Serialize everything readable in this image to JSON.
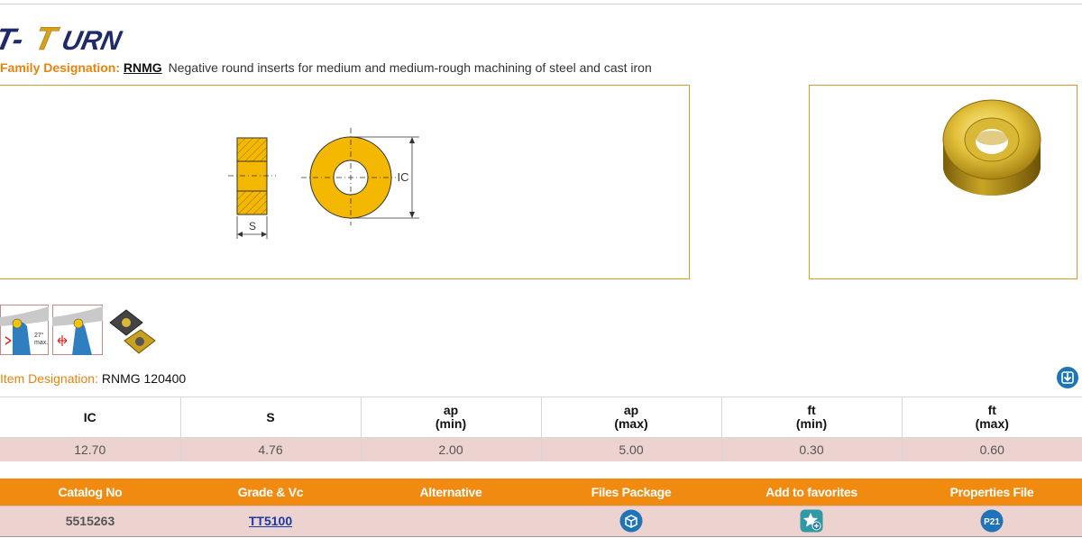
{
  "logo": {
    "text": "T-TURN",
    "colors": {
      "dark": "#1f2a6b",
      "gold": "#d7a21a"
    }
  },
  "family": {
    "label": "Family Designation:",
    "code": "RNMG",
    "description": "Negative round inserts for medium and medium-rough machining of steel and cast iron"
  },
  "drawing": {
    "dim_s": "S",
    "dim_ic": "IC"
  },
  "thumbs": {
    "angle_label_1": "27°",
    "angle_label_2": "max."
  },
  "item": {
    "label": "Item Designation:",
    "value": "RNMG 120400"
  },
  "dims_table": {
    "headers": [
      {
        "line1": "IC",
        "line2": ""
      },
      {
        "line1": "S",
        "line2": ""
      },
      {
        "line1": "ap",
        "line2": "(min)"
      },
      {
        "line1": "ap",
        "line2": "(max)"
      },
      {
        "line1": "ft",
        "line2": "(min)"
      },
      {
        "line1": "ft",
        "line2": "(max)"
      }
    ],
    "row": [
      "12.70",
      "4.76",
      "2.00",
      "5.00",
      "0.30",
      "0.60"
    ]
  },
  "catalog_table": {
    "headers": [
      "Catalog No",
      "Grade & Vc",
      "Alternative",
      "Files Package",
      "Add to favorites",
      "Properties File"
    ],
    "row": {
      "catalog_no": "5515263",
      "grade": "TT5100",
      "alternative": "",
      "properties_badge": "P21"
    },
    "icons": {
      "files": "package-icon",
      "favorites": "star-add-icon",
      "properties": "properties-file-icon"
    }
  },
  "colors": {
    "accent": "#f08a10",
    "row_bg": "#ecd3d0",
    "icon_blue": "#1f73b7",
    "insert_yellow": "#f5b800"
  }
}
